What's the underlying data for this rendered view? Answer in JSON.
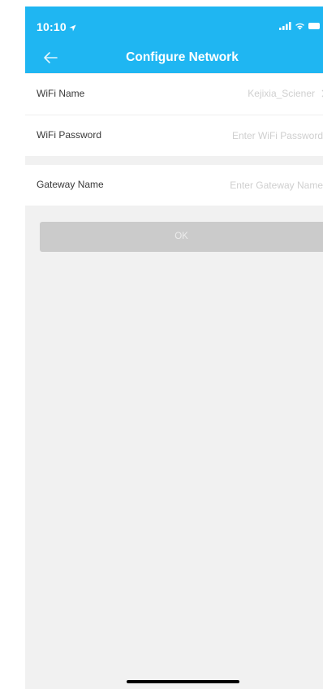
{
  "status_bar": {
    "time": "10:10"
  },
  "nav": {
    "title": "Configure Network"
  },
  "form": {
    "wifi_name": {
      "label": "WiFi Name",
      "value": "Kejixia_Sciener"
    },
    "wifi_password": {
      "label": "WiFi Password",
      "placeholder": "Enter WiFi Password"
    },
    "gateway_name": {
      "label": "Gateway Name",
      "placeholder": "Enter Gateway Name"
    }
  },
  "ok_button": {
    "label": "OK"
  },
  "colors": {
    "header": "#1fb6f2",
    "background": "#f1f1f1",
    "button_disabled": "#cbcbcb"
  },
  "icons": [
    "location-arrow-icon",
    "cellular-signal-icon",
    "wifi-icon",
    "battery-icon",
    "back-arrow-icon",
    "chevron-right-icon"
  ]
}
